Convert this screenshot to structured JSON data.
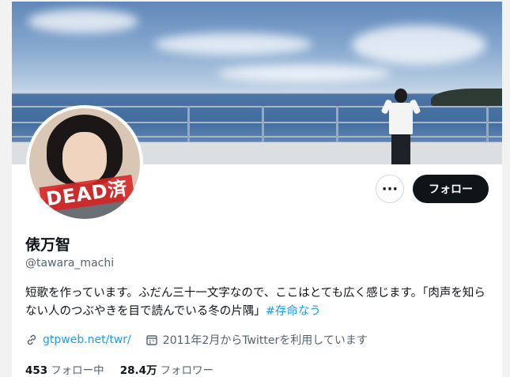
{
  "profile": {
    "display_name": "俵万智",
    "handle": "@tawara_machi",
    "bio_text": "短歌を作っています。ふだん三十一文字なので、ここはとても広く感じます。「肉声を知らない人のつぶやきを目で読んでいる冬の片隅」",
    "bio_hashtag": "#存命なう",
    "website": "gtpweb.net/twr/",
    "joined": "2011年2月からTwitterを利用しています",
    "following_count": "453",
    "following_label": "フォロー中",
    "followers_count": "28.4万",
    "followers_label": "フォロワー",
    "avatar_stamp": "DEAD済"
  },
  "actions": {
    "more_label": "···",
    "follow_label": "フォロー"
  },
  "icons": {
    "link": "link-icon",
    "calendar": "calendar-icon",
    "more": "more-icon"
  },
  "colors": {
    "accent": "#1d9bf0",
    "primary_text": "#0f1419",
    "secondary_text": "#536471",
    "follow_button_bg": "#0f1419",
    "stamp_red": "#d72323"
  }
}
